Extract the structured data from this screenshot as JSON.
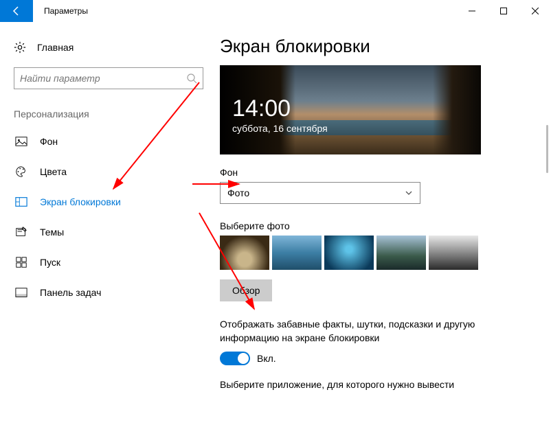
{
  "titlebar": {
    "title": "Параметры"
  },
  "sidebar": {
    "home": "Главная",
    "search_placeholder": "Найти параметр",
    "section": "Персонализация",
    "items": [
      {
        "label": "Фон"
      },
      {
        "label": "Цвета"
      },
      {
        "label": "Экран блокировки"
      },
      {
        "label": "Темы"
      },
      {
        "label": "Пуск"
      },
      {
        "label": "Панель задач"
      }
    ]
  },
  "content": {
    "heading": "Экран блокировки",
    "preview": {
      "time": "14:00",
      "date": "суббота, 16 сентября"
    },
    "bg_label": "Фон",
    "bg_value": "Фото",
    "choose_label": "Выберите фото",
    "browse": "Обзор",
    "tips_text": "Отображать забавные факты, шутки, подсказки и другую информацию на экране блокировки",
    "toggle_label": "Вкл.",
    "truncated": "Выберите приложение, для которого нужно вывести"
  }
}
